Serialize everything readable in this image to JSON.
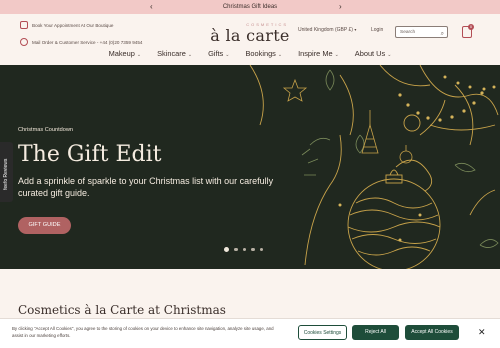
{
  "promo": {
    "text": "Christmas Gift Ideas",
    "prev": "‹",
    "next": "›"
  },
  "header": {
    "appointment": "Book Your Appointment At Our Boutique",
    "mail_order": "Mail Order & Customer Service - +44 (0)20 7359 9454",
    "logo_small": "COSMETICS",
    "logo_big": "à la carte",
    "region": "United Kingdom (GBP £)",
    "login": "Login",
    "search_placeholder": "Search",
    "bag_count": "0"
  },
  "nav": [
    {
      "label": "Makeup"
    },
    {
      "label": "Skincare"
    },
    {
      "label": "Gifts"
    },
    {
      "label": "Bookings"
    },
    {
      "label": "Inspire Me"
    },
    {
      "label": "About Us"
    }
  ],
  "hero": {
    "kicker": "Christmas Countdown",
    "title": "The Gift Edit",
    "subtitle": "Add a sprinkle of sparkle to your Christmas list with our carefully curated gift guide.",
    "cta": "GIFT GUIDE",
    "slides": 5,
    "active_slide": 1
  },
  "feefo": {
    "label": "feefo Reviews"
  },
  "section": {
    "title": "Cosmetics à la Carte at Christmas"
  },
  "cookie": {
    "text": "By clicking \"Accept All Cookies\", you agree to the storing of cookies on your device to enhance site navigation, analyze site usage, and assist in our marketing efforts.",
    "settings": "Cookies Settings",
    "reject": "Reject All",
    "accept": "Accept All Cookies",
    "close": "✕"
  },
  "colors": {
    "promo": "#f2c9c7",
    "hero_bg": "#20281f",
    "gold": "#c8a34a",
    "cta": "#b06262",
    "accept": "#1e4d3a"
  }
}
